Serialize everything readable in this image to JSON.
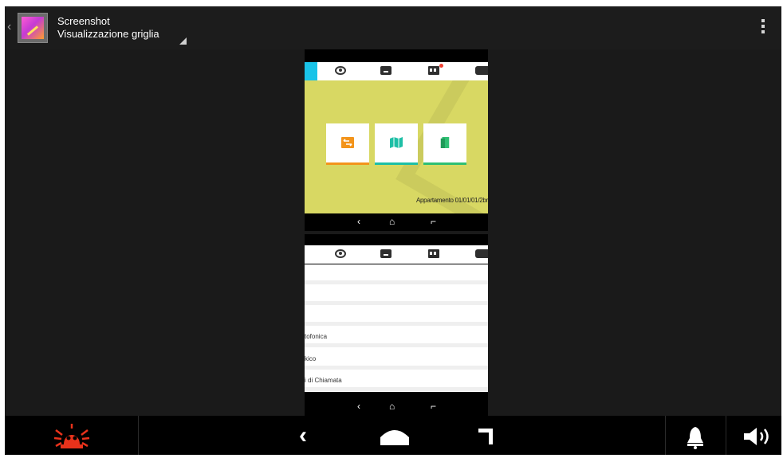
{
  "action_bar": {
    "title": "Screenshot",
    "subtitle": "Visualizzazione griglia",
    "up_glyph": "‹",
    "icon": "gallery-app-icon"
  },
  "thumbnail_top": {
    "footer_text": "Appartamento 01/01/01/2br",
    "nav": {
      "back": "‹",
      "home": "⌂",
      "recents": "⌐"
    },
    "tiles": [
      {
        "icon": "swap-icon",
        "accent": "#f3941b"
      },
      {
        "icon": "map-icon",
        "accent": "#1ebfa6"
      },
      {
        "icon": "door-icon",
        "accent": "#2fbf73"
      }
    ]
  },
  "thumbnail_bottom": {
    "list_items": [
      "tofonica",
      "kico",
      "i di Chiamata"
    ],
    "nav": {
      "back": "‹",
      "home": "⌂",
      "recents": "⌐"
    }
  },
  "navbar": {
    "back_glyph": "‹"
  },
  "colors": {
    "alarm": "#e8321b",
    "background": "#1a1a1a",
    "tile_yellow": "#d8d863",
    "cyan": "#19c3e8"
  }
}
